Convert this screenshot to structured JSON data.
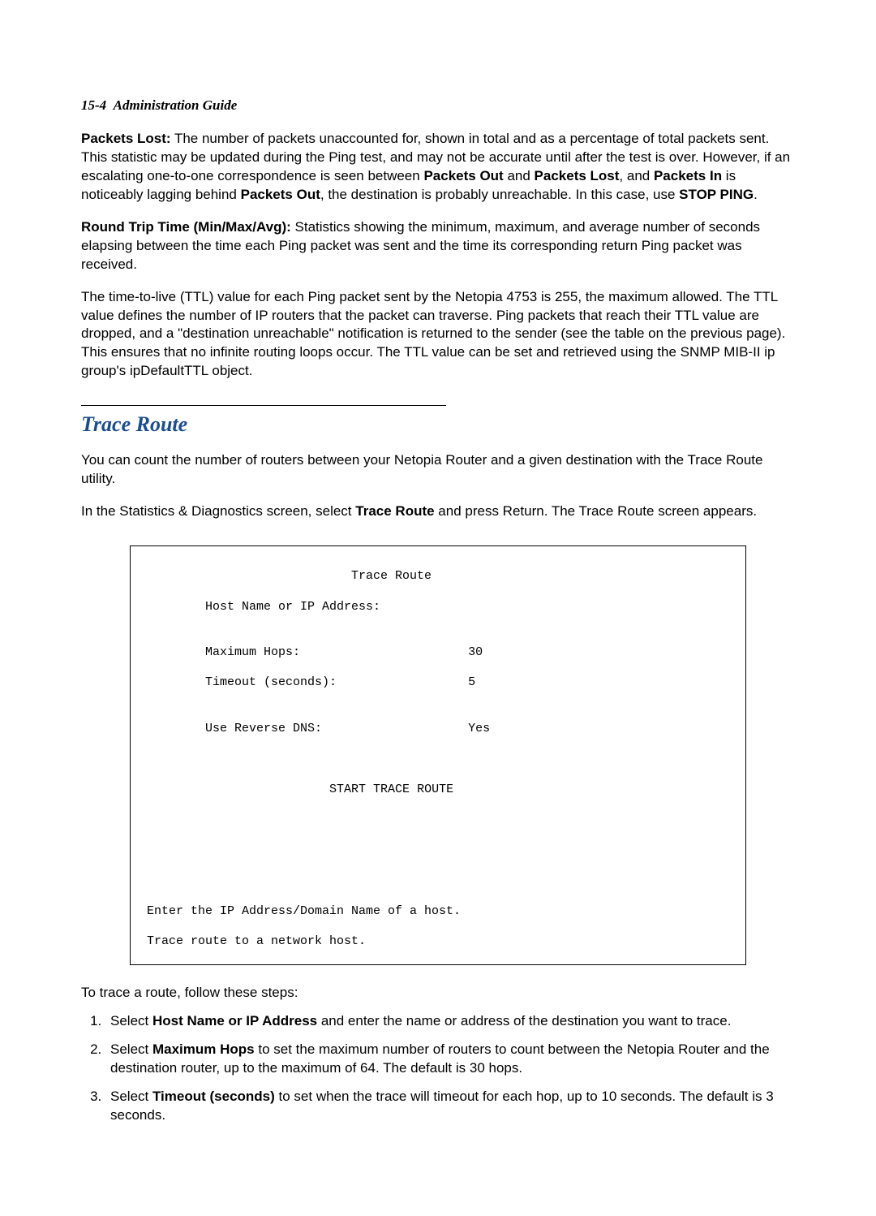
{
  "header": {
    "page_ref": "15-4",
    "title": "Administration Guide"
  },
  "para1": {
    "lead_bold": "Packets Lost:",
    "t1": "  The number of packets unaccounted for, shown in total and as a percentage of total packets sent. This statistic may be updated during the Ping test, and may not be accurate until after the test is over. However, if an escalating one-to-one correspondence is seen between ",
    "b1": "Packets Out",
    "t2": " and ",
    "b2": "Packets Lost",
    "t3": ", and ",
    "b3": "Packets In",
    "t4": " is noticeably lagging behind ",
    "b4": "Packets Out",
    "t5": ", the destination is probably unreachable. In this case, use ",
    "b5": "STOP PING",
    "t6": "."
  },
  "para2": {
    "lead_bold": "Round Trip Time (Min/Max/Avg):",
    "t1": "  Statistics showing the minimum, maximum, and average number of seconds elapsing between the time each Ping packet was sent and the time its corresponding return Ping packet was received."
  },
  "para3": {
    "t1": "The time-to-live (TTL) value for each Ping packet sent by the Netopia 4753 is 255, the maximum allowed. The TTL value defines the number of IP routers that the packet can traverse. Ping packets that reach their TTL value are dropped, and a \"destination unreachable\" notification is returned to the sender (see the table on the previous page). This ensures that no infinite routing loops occur. The TTL value can be set and retrieved using the SNMP MIB-II ip group's ipDefaultTTL object."
  },
  "section": {
    "heading": "Trace Route",
    "p1": "You can count the number of routers between your Netopia Router and a given destination with the Trace Route utility.",
    "p2_a": "In the Statistics & Diagnostics screen, select ",
    "p2_b": "Trace Route",
    "p2_c": " and press Return. The Trace Route screen appears."
  },
  "console": {
    "title": "Trace Route",
    "labels": {
      "host": "Host Name or IP Address:",
      "max_hops": "Maximum Hops:",
      "timeout": "Timeout (seconds):",
      "reverse_dns": "Use Reverse DNS:"
    },
    "values": {
      "max_hops": "30",
      "timeout": "5",
      "reverse_dns": "Yes"
    },
    "action": "START TRACE ROUTE",
    "hint1": "Enter the IP Address/Domain Name of a host.",
    "hint2": "Trace route to a network host."
  },
  "steps_intro": "To trace a route, follow these steps:",
  "steps": [
    {
      "b": "Host Name or IP Address",
      "pre": "Select ",
      "post": " and enter the name or address of the destination you want to trace."
    },
    {
      "b": "Maximum Hops",
      "pre": "Select ",
      "post": " to set the maximum number of routers to count between the Netopia Router and the destination router, up to the maximum of 64. The default is 30 hops."
    },
    {
      "b": "Timeout (seconds)",
      "pre": "Select ",
      "post": " to set when the trace will timeout for each hop, up to 10 seconds. The default is 3 seconds."
    }
  ]
}
